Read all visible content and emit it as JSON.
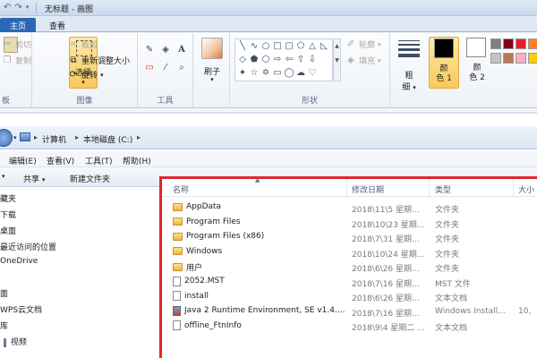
{
  "paint": {
    "title": "无标题 - 画图",
    "tabs": [
      "主页",
      "查看"
    ],
    "clipboard": {
      "paste_top": "粘",
      "paste_bottom": "板",
      "cut": "剪切",
      "copy": "复制"
    },
    "image": {
      "select": "选择",
      "crop": "裁剪",
      "resize": "重新调整大小",
      "rotate": "旋转",
      "label": "图像"
    },
    "tools": {
      "label": "工具",
      "text_tool": "A"
    },
    "brush": "刷子",
    "shapes": {
      "label": "形状",
      "outline": "轮廓",
      "fill": "填充"
    },
    "size": {
      "line1": "粗",
      "line2": "细"
    },
    "colors": {
      "color1_line1": "颜",
      "color1_line2": "色 1",
      "color2_line1": "颜",
      "color2_line2": "色 2",
      "color1": "#000000",
      "color2": "#ffffff",
      "palette": [
        "#7f7f7f",
        "#880015",
        "#ed1c24",
        "#ff7f27",
        "#c3c3c3",
        "#b97a57",
        "#ffaec9",
        "#ffc90e"
      ]
    }
  },
  "explorer": {
    "breadcrumb": [
      "计算机",
      "本地磁盘 (C:)"
    ],
    "menu": [
      "编辑(E)",
      "查看(V)",
      "工具(T)",
      "帮助(H)"
    ],
    "toolbar": [
      "共享",
      "新建文件夹"
    ],
    "nav": [
      "藏夹",
      "下载",
      "桌面",
      "最近访问的位置",
      "OneDrive",
      "面",
      "WPS云文档",
      "库",
      "视频"
    ],
    "columns": [
      "名称",
      "修改日期",
      "类型",
      "大小"
    ],
    "files": [
      {
        "name": "AppData",
        "date": "2018\\11\\5 星期...",
        "type": "文件夹",
        "size": "",
        "icon": "folder-icon"
      },
      {
        "name": "Program Files",
        "date": "2018\\10\\23 星期...",
        "type": "文件夹",
        "size": "",
        "icon": "folder-icon"
      },
      {
        "name": "Program Files (x86)",
        "date": "2018\\7\\31 星期...",
        "type": "文件夹",
        "size": "",
        "icon": "folder-icon"
      },
      {
        "name": "Windows",
        "date": "2018\\10\\24 星期...",
        "type": "文件夹",
        "size": "",
        "icon": "folder-icon"
      },
      {
        "name": "用户",
        "date": "2018\\6\\26 星期...",
        "type": "文件夹",
        "size": "",
        "icon": "folder-icon"
      },
      {
        "name": "2052.MST",
        "date": "2018\\7\\16 星期...",
        "type": "MST 文件",
        "size": "",
        "icon": "file-icon"
      },
      {
        "name": "install",
        "date": "2018\\6\\26 星期...",
        "type": "文本文档",
        "size": "",
        "icon": "file-icon"
      },
      {
        "name": "Java 2 Runtime Environment, SE v1.4....",
        "date": "2018\\7\\16 星期...",
        "type": "Windows Install...",
        "size": "10,",
        "icon": "java-icon"
      },
      {
        "name": "offline_FtnInfo",
        "date": "2018\\9\\4 星期二 ...",
        "type": "文本文档",
        "size": "",
        "icon": "file-icon"
      }
    ]
  }
}
